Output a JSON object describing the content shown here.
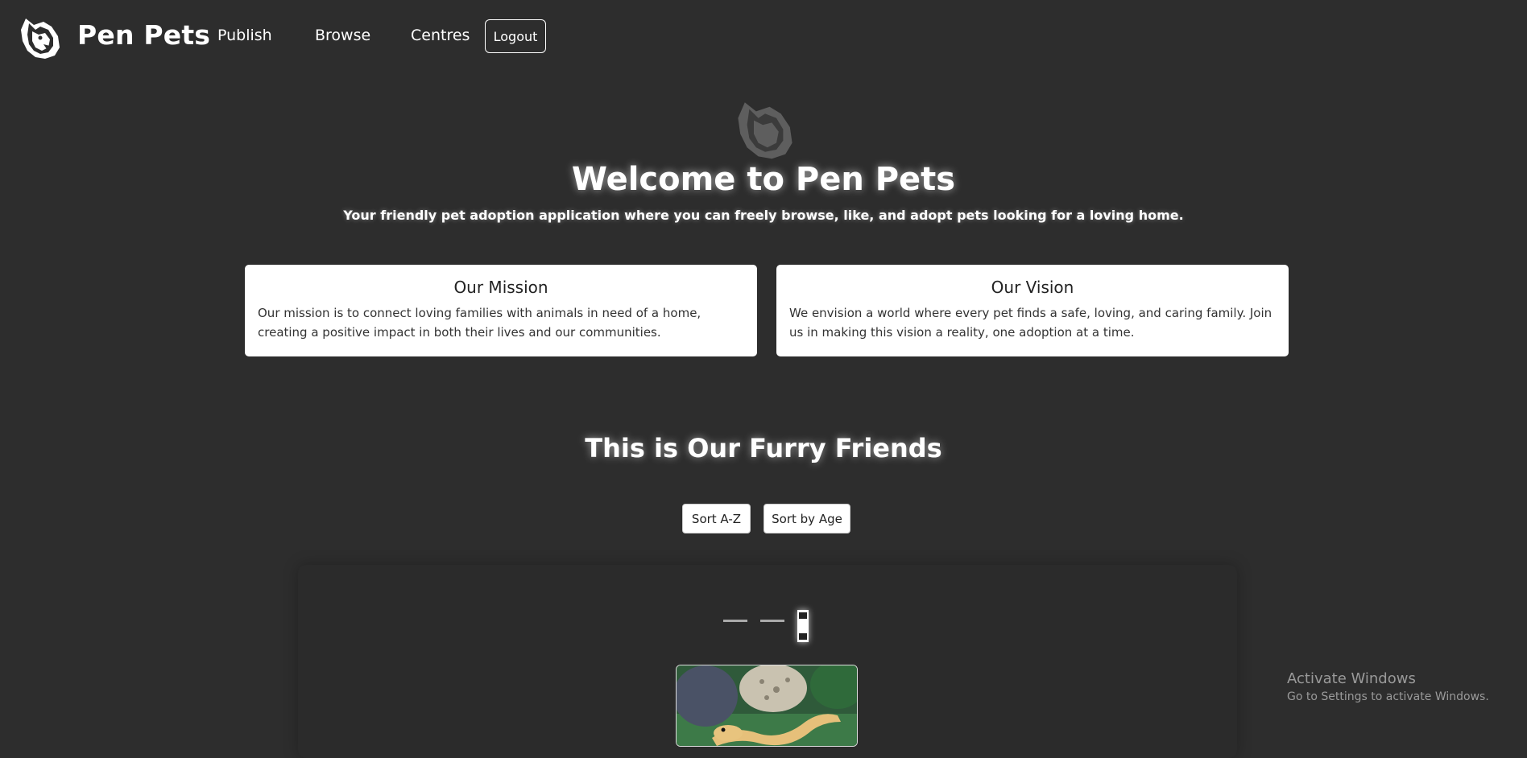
{
  "nav": {
    "brand": "Pen Pets",
    "links": [
      {
        "label": "Publish"
      },
      {
        "label": "Browse"
      },
      {
        "label": "Centres"
      }
    ],
    "logout_label": "Logout"
  },
  "hero": {
    "title": "Welcome to Pen Pets",
    "subtitle": "Your friendly pet adoption application where you can freely browse, like, and adopt pets looking for a loving home."
  },
  "cards": {
    "mission": {
      "title": "Our Mission",
      "text": "Our mission is to connect loving families with animals in need of a home, creating a positive impact in both their lives and our communities."
    },
    "vision": {
      "title": "Our Vision",
      "text": "We envision a world where every pet finds a safe, loving, and caring family. Join us in making this vision a reality, one adoption at a time."
    }
  },
  "friends": {
    "title": "This is Our Furry Friends",
    "sort_az_label": "Sort A-Z",
    "sort_age_label": "Sort by Age"
  },
  "carousel": {
    "active_index": 3,
    "total": 3
  },
  "watermark": {
    "title": "Activate Windows",
    "subtitle": "Go to Settings to activate Windows."
  },
  "icons": {
    "logo": "dog-head-logo-icon",
    "hero_logo": "dog-head-logo-icon"
  }
}
